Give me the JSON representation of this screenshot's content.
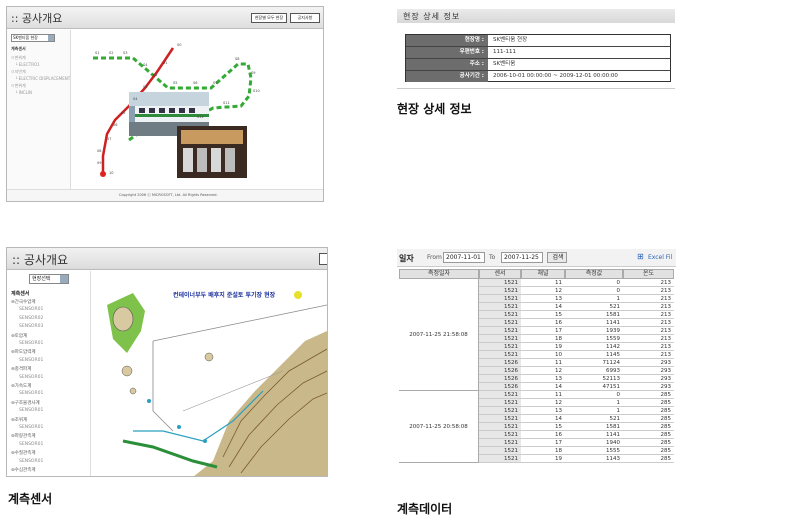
{
  "panel1": {
    "title": ":: 공사개요",
    "buttons": [
      "현장별 모두 현장",
      "공지사항"
    ],
    "select_value": "SK벤티움 현장",
    "tree_header": "계측센서",
    "tree_items": [
      "ㅁ변위계",
      "└ ELECTRO1",
      "ㅁ지반계",
      "└ ELECTRIC DISPLACEMENT",
      "ㅁ변위계",
      "└ INCLIN"
    ],
    "copyright": "Copyright 2006 ⓒ MICROSOFT, Ltd. All Rights Reserved.",
    "stations_red": [
      "00",
      "01",
      "02",
      "03",
      "04",
      "05",
      "06",
      "07",
      "08",
      "09",
      "10"
    ],
    "stations_green": [
      "S1",
      "S2",
      "S3",
      "S4",
      "S5",
      "S6",
      "S7",
      "S8",
      "S9",
      "S10",
      "S11",
      "S12"
    ]
  },
  "panel2": {
    "title": "현장 상세 정보",
    "rows": [
      {
        "label": "현장명 :",
        "value": "SK벤티움 현장"
      },
      {
        "label": "우편번호 :",
        "value": "111-111"
      },
      {
        "label": "주소 :",
        "value": "SK벤티움"
      },
      {
        "label": "공사기간 :",
        "value": "2006-10-01 00:00:00 ~ 2009-12-01 00:00:00"
      }
    ]
  },
  "captions": {
    "detail": "현장 상세 정보",
    "sensor": "계측센서",
    "data": "계측데이터"
  },
  "panel3": {
    "title": ":: 공사개요",
    "select_value": "현장선택",
    "tree_header": "계측센서",
    "tree_items": [
      "⊖간극수압계",
      "SENSOR01",
      "SENSOR02",
      "SENSOR03",
      "⊖토압계",
      "SENSOR01",
      "⊖파도압력계",
      "SENSOR01",
      "⊖충격파계",
      "SENSOR01",
      "⊖가속도계",
      "SENSOR01",
      "⊖구조물경사계",
      "SENSOR01",
      "⊖조위계",
      "SENSOR01",
      "⊖파랑관측계",
      "SENSOR01",
      "⊖수질관측계",
      "SENSOR01",
      "⊖수심관측계"
    ],
    "map_title": "컨테이너부두 배후지 준설토 투기장 현장"
  },
  "panel4": {
    "label_date": "일자",
    "label_from": "From",
    "from_value": "2007-11-01",
    "label_to": "To",
    "to_value": "2007-11-25",
    "search_button": "검색",
    "excel_link": "Excel Fil",
    "headers": [
      "측정일자",
      "센서",
      "채널",
      "측정값",
      "온도"
    ],
    "groups": [
      {
        "date": "2007-11-25 21:58:08",
        "rows": [
          [
            "1521",
            "11",
            "0",
            "213"
          ],
          [
            "1521",
            "12",
            "0",
            "213"
          ],
          [
            "1521",
            "13",
            "1",
            "213"
          ],
          [
            "1521",
            "14",
            "521",
            "213"
          ],
          [
            "1521",
            "15",
            "1581",
            "213"
          ],
          [
            "1521",
            "16",
            "1141",
            "213"
          ],
          [
            "1521",
            "17",
            "1939",
            "213"
          ],
          [
            "1521",
            "18",
            "1559",
            "213"
          ],
          [
            "1521",
            "19",
            "1142",
            "213"
          ],
          [
            "1521",
            "10",
            "1145",
            "213"
          ],
          [
            "1526",
            "11",
            "71124",
            "293"
          ],
          [
            "1526",
            "12",
            "6993",
            "293"
          ],
          [
            "1526",
            "13",
            "52113",
            "293"
          ],
          [
            "1526",
            "14",
            "47151",
            "293"
          ]
        ]
      },
      {
        "date": "2007-11-25 20:58:08",
        "rows": [
          [
            "1521",
            "11",
            "0",
            "285"
          ],
          [
            "1521",
            "12",
            "1",
            "285"
          ],
          [
            "1521",
            "13",
            "1",
            "285"
          ],
          [
            "1521",
            "14",
            "521",
            "285"
          ],
          [
            "1521",
            "15",
            "1581",
            "285"
          ],
          [
            "1521",
            "16",
            "1141",
            "285"
          ],
          [
            "1521",
            "17",
            "1940",
            "285"
          ],
          [
            "1521",
            "18",
            "1555",
            "285"
          ],
          [
            "1521",
            "19",
            "1143",
            "285"
          ]
        ]
      }
    ]
  }
}
